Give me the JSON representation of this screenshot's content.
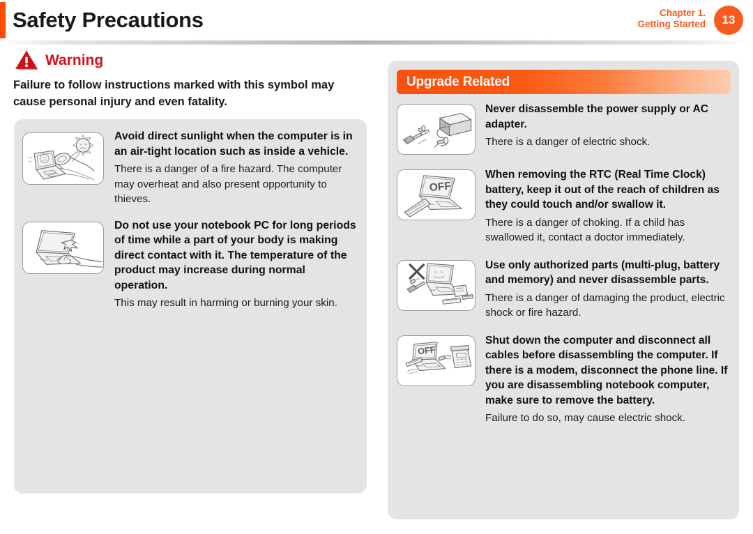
{
  "header": {
    "title": "Safety Precautions",
    "chapter_line1": "Chapter 1.",
    "chapter_line2": "Getting Started",
    "page_number": "13",
    "accent_color": "#fa4d02",
    "chapter_text_color": "#f45b1e"
  },
  "left_column": {
    "warning": {
      "label": "Warning",
      "icon": "warning-triangle-icon",
      "color": "#d2121a",
      "description": "Failure to follow instructions marked with this symbol may cause personal injury and even fatality."
    },
    "items": [
      {
        "icon": "car-dashboard-laptop-sun-icon",
        "title": "Avoid direct sunlight when the computer is in an air-tight location such as inside a vehicle.",
        "body": "There is a danger of a fire hazard. The computer may overheat and also present opportunity to thieves."
      },
      {
        "icon": "laptop-hand-heat-icon",
        "title": "Do not use your notebook PC for long periods of time while a part of your body is making direct contact with it. The temperature of the product may increase during normal operation.",
        "body": "This may result in harming or burning your skin."
      }
    ]
  },
  "right_column": {
    "section_title": "Upgrade Related",
    "section_color": "#f9500b",
    "items": [
      {
        "icon": "ac-adapter-screwdriver-icon",
        "title": "Never disassemble the power supply or AC adapter.",
        "body": "There is a danger of electric shock."
      },
      {
        "icon": "laptop-off-rtc-battery-icon",
        "title": "When removing the RTC (Real Time Clock) battery, keep it out of the reach of children as they could touch and/or swallow it.",
        "body": "There is a danger of choking. If a child has swallowed it, contact a doctor immediately."
      },
      {
        "icon": "laptop-unauthorized-parts-x-icon",
        "title": "Use only authorized parts (multi-plug, battery and memory) and never disassemble parts.",
        "body": "There is a danger of damaging the product, electric shock or fire hazard."
      },
      {
        "icon": "laptop-off-phone-modem-icon",
        "title": "Shut down the computer and disconnect all cables before disassembling the computer. If there is a modem, disconnect the phone line. If you are disassembling notebook computer, make sure to remove the battery.",
        "body": "Failure to do so, may cause electric shock."
      }
    ]
  }
}
